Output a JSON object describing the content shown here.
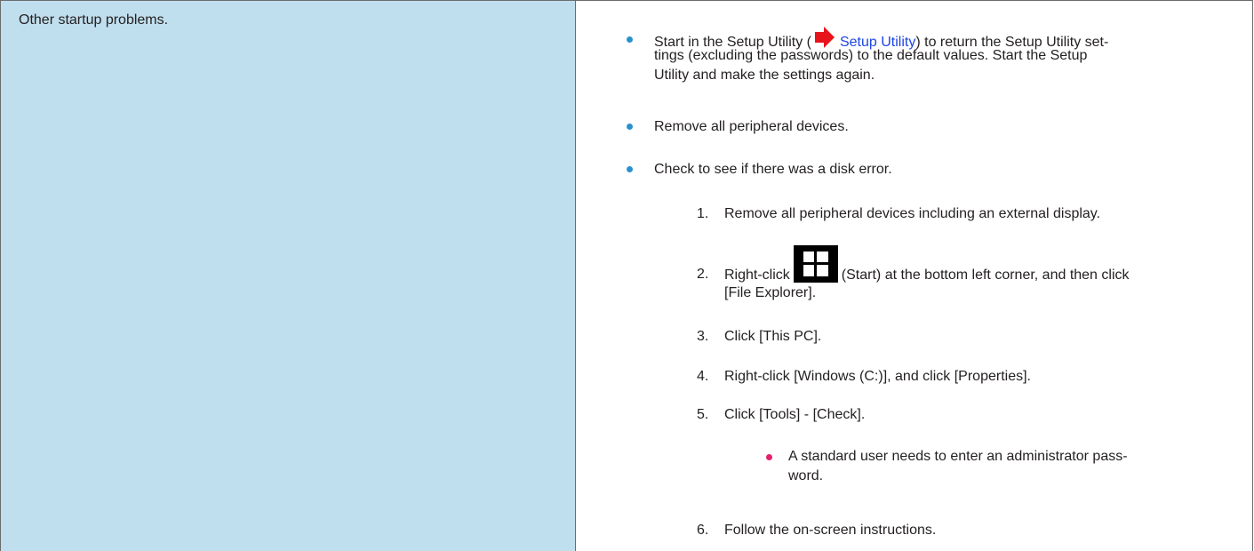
{
  "left": {
    "text": "Other startup problems."
  },
  "bullets": [
    {
      "line1_pre": "Start in the Setup Utility (",
      "link": "Setup Utility",
      "line1_post": ") to return the Setup Utility set-",
      "line2": "tings (excluding the passwords) to the default values. Start the Setup",
      "line3": "Utility and make the settings again."
    },
    {
      "text": "Remove all peripheral devices."
    },
    {
      "text": "Check to see if there was a disk error."
    }
  ],
  "steps": [
    {
      "num": "1.",
      "text": "Remove all peripheral devices including an external display."
    },
    {
      "num": "2.",
      "pre": "Right-click",
      "post": "(Start) at the bottom left corner, and then click",
      "line2": "[File Explorer]."
    },
    {
      "num": "3.",
      "text": "Click [This PC]."
    },
    {
      "num": "4.",
      "text": "Right-click [Windows (C:)], and click [Properties]."
    },
    {
      "num": "5.",
      "text": "Click [Tools] - [Check]."
    },
    {
      "num": "6.",
      "text": "Follow the on-screen instructions."
    }
  ],
  "note": {
    "line1": "A standard user needs to enter an administrator pass-",
    "line2": "word."
  },
  "icons": {
    "arrow": "red-arrow-icon",
    "start": "windows-start-icon"
  },
  "colors": {
    "left_bg": "#c0dfee",
    "bullet": "#2a91cf",
    "note_bullet": "#e5206f",
    "link": "#1e46e6"
  }
}
